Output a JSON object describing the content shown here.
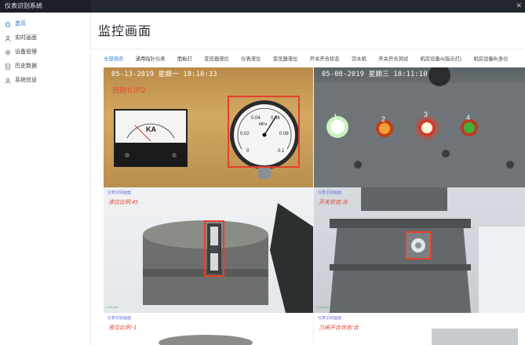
{
  "app": {
    "title": "仪表识别系统",
    "close_glyph": "✕"
  },
  "sidebar": {
    "items": [
      {
        "label": "首页",
        "icon": "home-icon",
        "active": true
      },
      {
        "label": "实时画面",
        "icon": "person-icon",
        "active": false
      },
      {
        "label": "设备管理",
        "icon": "gear-icon",
        "active": false
      },
      {
        "label": "历史数据",
        "icon": "document-icon",
        "active": false
      },
      {
        "label": "系统信息",
        "icon": "user-icon",
        "active": false
      }
    ]
  },
  "main": {
    "title": "监控画面",
    "tabs": [
      {
        "label": "全部测点",
        "active": true
      },
      {
        "label": "通用指针仪表",
        "active": false
      },
      {
        "label": "面板灯",
        "active": false
      },
      {
        "label": "变压器液位",
        "active": false
      },
      {
        "label": "仪表液位",
        "active": false
      },
      {
        "label": "变压器液位",
        "active": false
      },
      {
        "label": "开关开合状态",
        "active": false
      },
      {
        "label": "饮水机",
        "active": false
      },
      {
        "label": "开关开合测试",
        "active": false
      },
      {
        "label": "机房设备A(指示灯)",
        "active": false
      },
      {
        "label": "机房设备B(多仪",
        "active": false
      }
    ]
  },
  "feeds": {
    "feed1": {
      "timestamp": "05-13-2019 星期一 18:10:33",
      "reading": "识别:0.072",
      "ammeter_unit": "KA",
      "gauge_values": [
        "0.04",
        "0.06",
        "0.02",
        "0.08",
        "0",
        "0.1"
      ],
      "gauge_unit": "MPa"
    },
    "feed2": {
      "timestamp": "05-08-2019 星期三 18:11:10",
      "light_numbers": [
        "1",
        "2",
        "3",
        "4"
      ]
    },
    "feed3": {
      "system_tag": "仪表识别画面",
      "reading": "液位比例:45"
    },
    "feed4": {
      "system_tag": "仪表识别画面",
      "reading": "开关状态:合"
    },
    "feed5": {
      "system_tag": "仪表识别画面",
      "reading": "液位比例:-1"
    },
    "feed6": {
      "system_tag": "仪表识别画面",
      "reading": "刀闸开合状态:合"
    }
  },
  "colors": {
    "accent": "#1f74d6",
    "highlight": "#e4412c",
    "topbar": "#23272e"
  }
}
